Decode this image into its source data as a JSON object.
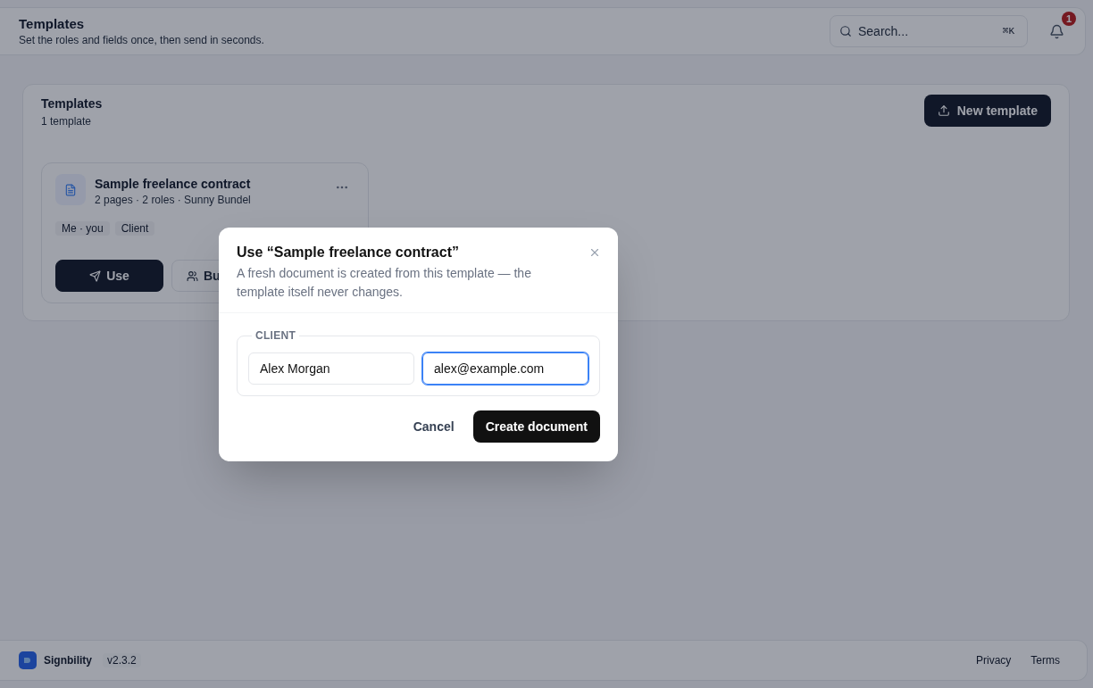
{
  "header": {
    "title": "Templates",
    "subtitle": "Set the roles and fields once, then send in seconds.",
    "search": {
      "placeholder": "Search...",
      "shortcut": "⌘K"
    },
    "notifications": {
      "badge": "1"
    }
  },
  "main": {
    "title": "Templates",
    "count": "1 template",
    "new_button": "New template",
    "templates": [
      {
        "title": "Sample freelance contract",
        "meta": "2 pages · 2 roles · Sunny Bundel",
        "roles": [
          "Me · you",
          "Client"
        ],
        "actions": [
          {
            "label": "Use",
            "kind": "primary"
          },
          {
            "label": "Bu",
            "kind": "secondary"
          }
        ]
      }
    ]
  },
  "footer": {
    "brand": "Signbility",
    "version": "v2.3.2",
    "links": [
      "Privacy",
      "Terms"
    ]
  },
  "dialog": {
    "title": "Use “Sample freelance contract”",
    "description": "A fresh document is created from this template — the template itself never changes.",
    "group": {
      "legend": "CLIENT",
      "fields": [
        {
          "value": "Alex Morgan",
          "focused": false
        },
        {
          "value": "alex@example.com",
          "focused": true
        }
      ]
    },
    "buttons": [
      {
        "label": "Cancel",
        "kind": "ghost"
      },
      {
        "label": "Create document",
        "kind": "primary"
      }
    ]
  }
}
